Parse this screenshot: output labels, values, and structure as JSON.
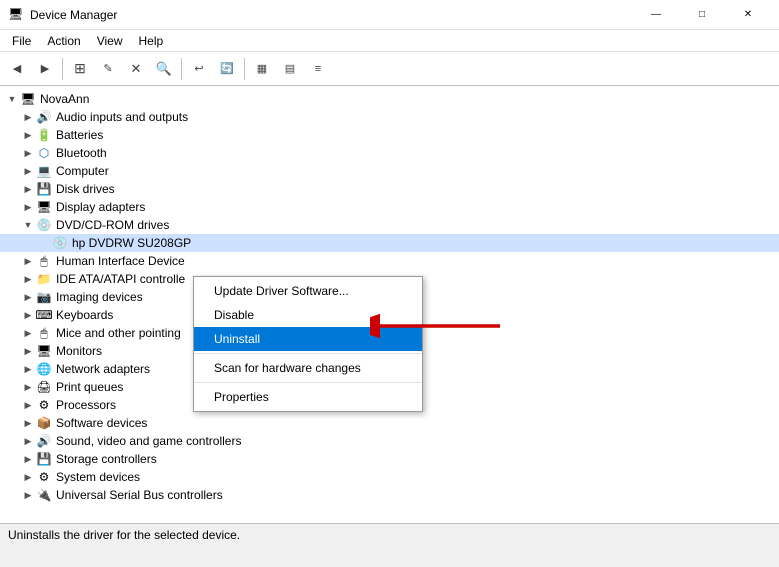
{
  "titleBar": {
    "appName": "Device Manager",
    "iconSymbol": "🖥",
    "controls": {
      "minimize": "—",
      "maximize": "□",
      "close": "✕"
    }
  },
  "menuBar": {
    "items": [
      "File",
      "Action",
      "View",
      "Help"
    ]
  },
  "toolbar": {
    "buttons": [
      "◀",
      "▶",
      "⬜",
      "✎",
      "🔍",
      "⬜",
      "↩",
      "🗑",
      "▦",
      "▤",
      "≡"
    ]
  },
  "tree": {
    "rootLabel": "NovaAnn",
    "items": [
      {
        "label": "Audio inputs and outputs",
        "indent": 1,
        "icon": "🔊",
        "hasExpand": true,
        "expanded": false
      },
      {
        "label": "Batteries",
        "indent": 1,
        "icon": "🔋",
        "hasExpand": true,
        "expanded": false
      },
      {
        "label": "Bluetooth",
        "indent": 1,
        "icon": "📶",
        "hasExpand": true,
        "expanded": false
      },
      {
        "label": "Computer",
        "indent": 1,
        "icon": "💻",
        "hasExpand": true,
        "expanded": false
      },
      {
        "label": "Disk drives",
        "indent": 1,
        "icon": "💾",
        "hasExpand": true,
        "expanded": false
      },
      {
        "label": "Display adapters",
        "indent": 1,
        "icon": "🖥",
        "hasExpand": true,
        "expanded": false
      },
      {
        "label": "DVD/CD-ROM drives",
        "indent": 1,
        "icon": "💿",
        "hasExpand": true,
        "expanded": true
      },
      {
        "label": "hp DVDRW  SU208GP",
        "indent": 2,
        "icon": "💿",
        "hasExpand": false,
        "expanded": false,
        "selected": true
      },
      {
        "label": "Human Interface Device",
        "indent": 1,
        "icon": "🖱",
        "hasExpand": true,
        "expanded": false
      },
      {
        "label": "IDE ATA/ATAPI controlle",
        "indent": 1,
        "icon": "📁",
        "hasExpand": true,
        "expanded": false
      },
      {
        "label": "Imaging devices",
        "indent": 1,
        "icon": "📷",
        "hasExpand": true,
        "expanded": false
      },
      {
        "label": "Keyboards",
        "indent": 1,
        "icon": "⌨",
        "hasExpand": true,
        "expanded": false
      },
      {
        "label": "Mice and other pointing",
        "indent": 1,
        "icon": "🖱",
        "hasExpand": true,
        "expanded": false
      },
      {
        "label": "Monitors",
        "indent": 1,
        "icon": "🖥",
        "hasExpand": true,
        "expanded": false
      },
      {
        "label": "Network adapters",
        "indent": 1,
        "icon": "🌐",
        "hasExpand": true,
        "expanded": false
      },
      {
        "label": "Print queues",
        "indent": 1,
        "icon": "🖨",
        "hasExpand": true,
        "expanded": false
      },
      {
        "label": "Processors",
        "indent": 1,
        "icon": "⚙",
        "hasExpand": true,
        "expanded": false
      },
      {
        "label": "Software devices",
        "indent": 1,
        "icon": "📦",
        "hasExpand": true,
        "expanded": false
      },
      {
        "label": "Sound, video and game controllers",
        "indent": 1,
        "icon": "🔊",
        "hasExpand": true,
        "expanded": false
      },
      {
        "label": "Storage controllers",
        "indent": 1,
        "icon": "💾",
        "hasExpand": true,
        "expanded": false
      },
      {
        "label": "System devices",
        "indent": 1,
        "icon": "⚙",
        "hasExpand": true,
        "expanded": false
      },
      {
        "label": "Universal Serial Bus controllers",
        "indent": 1,
        "icon": "🔌",
        "hasExpand": true,
        "expanded": false
      }
    ]
  },
  "contextMenu": {
    "items": [
      {
        "label": "Update Driver Software...",
        "type": "item"
      },
      {
        "label": "Disable",
        "type": "item"
      },
      {
        "label": "Uninstall",
        "type": "item",
        "active": true
      },
      {
        "label": "Scan for hardware changes",
        "type": "item"
      },
      {
        "label": "Properties",
        "type": "item"
      }
    ]
  },
  "statusBar": {
    "text": "Uninstalls the driver for the selected device."
  }
}
